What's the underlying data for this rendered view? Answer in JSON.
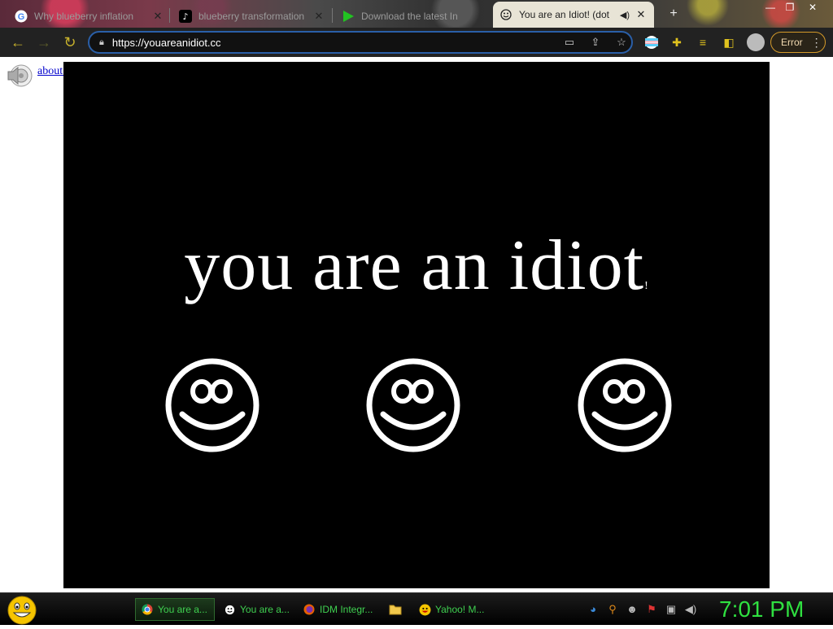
{
  "browser": {
    "tabs": [
      {
        "title": "Why blueberry inflation",
        "icon": "google-icon"
      },
      {
        "title": "blueberry transformation",
        "icon": "tiktok-icon"
      },
      {
        "title": "Download the latest In",
        "icon": "play-icon"
      },
      {
        "title": "You are an Idiot! (dot",
        "icon": "smiley-icon",
        "active": true
      }
    ],
    "url": "https://youareanidiot.cc",
    "error_label": "Error"
  },
  "page": {
    "about_link": "about these",
    "headline": "you are an idiot",
    "headline_suffix": "!"
  },
  "taskbar": {
    "items": [
      {
        "label": "You are a...",
        "icon": "chrome-icon",
        "active": true
      },
      {
        "label": "You are a...",
        "icon": "smiley-icon"
      },
      {
        "label": "IDM Integr...",
        "icon": "firefox-icon"
      },
      {
        "label": "",
        "icon": "folder-icon"
      },
      {
        "label": "Yahoo! M...",
        "icon": "yahoo-messenger-icon"
      }
    ],
    "clock": "7:01 PM"
  },
  "colors": {
    "accent": "#2fe040",
    "address_border": "#2a5fa8",
    "error_border": "#d49a2a",
    "stage_bg": "#000000"
  }
}
